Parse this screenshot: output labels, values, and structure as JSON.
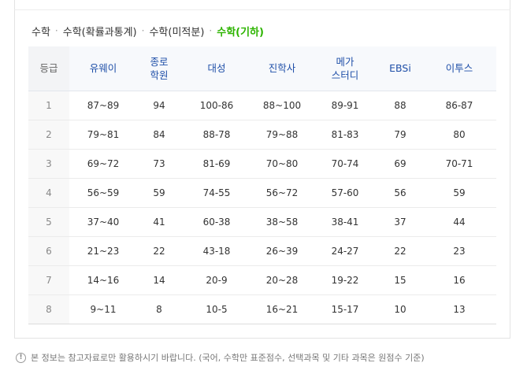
{
  "subtabs": [
    {
      "label": "수학",
      "active": false
    },
    {
      "label": "수학(확률과통계)",
      "active": false
    },
    {
      "label": "수학(미적분)",
      "active": false
    },
    {
      "label": "수학(기하)",
      "active": true
    }
  ],
  "separator": "·",
  "table": {
    "headers": [
      "등급",
      "유웨이",
      "종로\n학원",
      "대성",
      "진학사",
      "메가\n스터디",
      "EBSi",
      "이투스"
    ],
    "rows": [
      [
        "1",
        "87~89",
        "94",
        "100-86",
        "88~100",
        "89-91",
        "88",
        "86-87"
      ],
      [
        "2",
        "79~81",
        "84",
        "88-78",
        "79~88",
        "81-83",
        "79",
        "80"
      ],
      [
        "3",
        "69~72",
        "73",
        "81-69",
        "70~80",
        "70-74",
        "69",
        "70-71"
      ],
      [
        "4",
        "56~59",
        "59",
        "74-55",
        "56~72",
        "57-60",
        "56",
        "59"
      ],
      [
        "5",
        "37~40",
        "41",
        "60-38",
        "38~58",
        "38-41",
        "37",
        "44"
      ],
      [
        "6",
        "21~23",
        "22",
        "43-18",
        "26~39",
        "24-27",
        "22",
        "23"
      ],
      [
        "7",
        "14~16",
        "14",
        "20-9",
        "20~28",
        "19-22",
        "15",
        "16"
      ],
      [
        "8",
        "9~11",
        "8",
        "10-5",
        "16~21",
        "15-17",
        "10",
        "13"
      ]
    ]
  },
  "notice": {
    "icon_glyph": "!",
    "text": "본 정보는 참고자료로만 활용하시기 바랍니다. (국어, 수학만 표준점수, 선택과목 및 기타 과목은 원점수 기준)"
  },
  "colors": {
    "active_tab": "#2db400",
    "header_text": "#1f4fa8"
  }
}
